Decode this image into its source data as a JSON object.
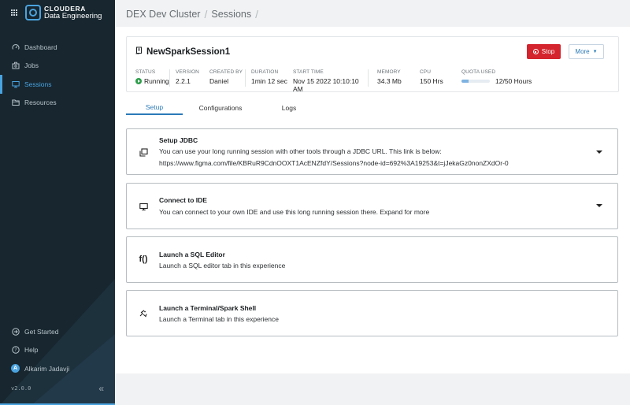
{
  "app": {
    "brand_top": "CLOUDERA",
    "brand_bottom": "Data Engineering"
  },
  "sidebar": {
    "items": [
      {
        "label": "Dashboard",
        "icon": "dashboard-gauge-icon",
        "active": false
      },
      {
        "label": "Jobs",
        "icon": "briefcase-icon",
        "active": false
      },
      {
        "label": "Sessions",
        "icon": "monitor-icon",
        "active": true
      },
      {
        "label": "Resources",
        "icon": "folder-icon",
        "active": false
      }
    ],
    "bottom_items": [
      {
        "label": "Get Started",
        "icon": "arrow-circle-icon"
      },
      {
        "label": "Help",
        "icon": "help-circle-icon"
      },
      {
        "label": "Alkarim Jadavji",
        "icon": "avatar",
        "initial": "A"
      }
    ],
    "version": "v2.0.0",
    "collapse_icon": "double-chevron-left-icon"
  },
  "breadcrumb": {
    "items": [
      "DEX Dev Cluster",
      "Sessions"
    ],
    "separator": "/"
  },
  "session": {
    "title": "NewSparkSession1",
    "title_icon": "spark-session-icon",
    "stop_label": "Stop",
    "more_label": "More",
    "meta": {
      "status_label": "STATUS",
      "status_value": "Running",
      "version_label": "VERSION",
      "version_value": "2.2.1",
      "created_label": "CREATED BY",
      "created_value": "Daniel",
      "duration_label": "DURATION",
      "duration_value": "1min 12 sec",
      "start_label": "START TIME",
      "start_value": "Nov 15 2022 10:10:10 AM",
      "memory_label": "MEMORY",
      "memory_value": "34.3 Mb",
      "cpu_label": "CPU",
      "cpu_value": "150 Hrs",
      "quota_label": "QUOTA USED",
      "quota_value": "12/50 Hours",
      "quota_fraction": 0.24
    }
  },
  "tabs": [
    {
      "label": "Setup",
      "active": true
    },
    {
      "label": "Configurations",
      "active": false
    },
    {
      "label": "Logs",
      "active": false
    }
  ],
  "cards": [
    {
      "title": "Setup JDBC",
      "desc": "You can use your long running session with other tools through a JDBC URL. This link is below:",
      "link": "https://www.figma.com/file/KBRuR9CdnOOXT1AcENZfdY/Sessions?node-id=692%3A19253&t=jJekaGz0nonZXdOr-0",
      "icon": "copy-icon",
      "expandable": true
    },
    {
      "title": "Connect to IDE",
      "desc": "You can connect to your own IDE and use this long running session there. Expand for more",
      "icon": "monitor-icon",
      "expandable": true
    },
    {
      "title": "Launch a SQL Editor",
      "desc": "Launch a SQL editor tab in this experience",
      "icon": "function-icon",
      "icon_text": "f()",
      "expandable": false
    },
    {
      "title": "Launch a Terminal/Spark Shell",
      "desc": "Launch a Terminal tab in this experience",
      "icon": "spark-shell-icon",
      "expandable": false
    }
  ],
  "colors": {
    "sidebar_bg": "#17262f",
    "accent": "#2a7ab8",
    "stop": "#d4242d",
    "running": "#2e9d4a"
  }
}
